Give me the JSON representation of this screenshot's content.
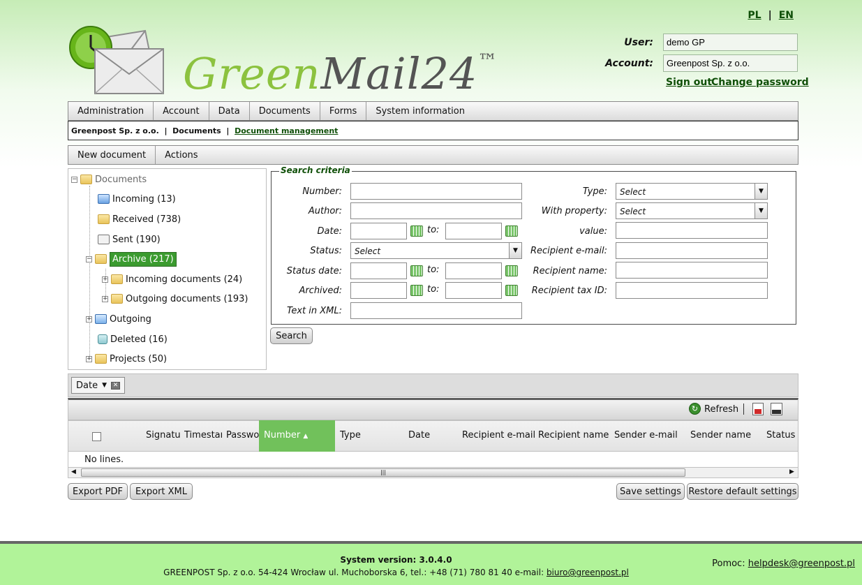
{
  "header": {
    "lang": [
      "PL",
      "EN"
    ],
    "lang_sep": "|",
    "logo_green": "Green",
    "logo_gray": "Mail24",
    "logo_tm": "™",
    "user_label": "User:",
    "user_value": "demo GP",
    "account_label": "Account:",
    "account_value": "Greenpost Sp. z o.o.",
    "sign_out": "Sign out",
    "change_password": "Change password"
  },
  "main_menu": [
    "Administration",
    "Account",
    "Data",
    "Documents",
    "Forms",
    "System information"
  ],
  "breadcrumb": {
    "company": "Greenpost Sp. z o.o.",
    "section": "Documents",
    "current": "Document management",
    "sep": "  |  "
  },
  "sub_menu": [
    "New document",
    "Actions"
  ],
  "tree": {
    "root": "Documents",
    "incoming": "Incoming (13)",
    "received": "Received (738)",
    "sent": "Sent (190)",
    "archive": "Archive (217)",
    "incoming_documents": "Incoming documents (24)",
    "outgoing_documents": "Outgoing documents (193)",
    "outgoing": "Outgoing",
    "deleted": "Deleted (16)",
    "projects": "Projects (50)"
  },
  "criteria": {
    "legend": "Search criteria",
    "number": "Number:",
    "author": "Author:",
    "date": "Date:",
    "status": "Status:",
    "status_date": "Status date:",
    "archived": "Archived:",
    "text_in_xml": "Text in XML:",
    "to": "to:",
    "type": "Type:",
    "with_property": "With property:",
    "value": "value:",
    "recipient_email": "Recipient e-mail:",
    "recipient_name": "Recipient name:",
    "recipient_tax_id": "Recipient tax ID:",
    "select_placeholder": "Select",
    "search_button": "Search"
  },
  "grid": {
    "group_chip": "Date",
    "refresh": "Refresh",
    "columns": [
      "Signatur",
      "Timestam",
      "Passwor",
      "Number",
      "Type",
      "Date",
      "Recipient e-mail",
      "Recipient name",
      "Sender e-mail",
      "Sender name",
      "Status"
    ],
    "sort_indicator": "▲",
    "empty": "No lines."
  },
  "bottom_buttons": {
    "export_pdf": "Export PDF",
    "export_xml": "Export XML",
    "save_settings": "Save settings",
    "restore_defaults": "Restore default settings"
  },
  "footer": {
    "version": "System version: 3.0.4.0",
    "address": "GREENPOST Sp. z o.o. 54-424 Wrocław ul. Muchoborska 6, tel.: +48 (71) 780 81 40 e-mail: ",
    "email": "biuro@greenpost.pl",
    "help_label": "Pomoc: ",
    "help_email": "helpdesk@greenpost.pl"
  },
  "colors": {
    "accent_green": "#3b9b2f",
    "sorted_column": "#71c15b",
    "footer_bg": "#b1f399",
    "link": "#0f4f08"
  }
}
